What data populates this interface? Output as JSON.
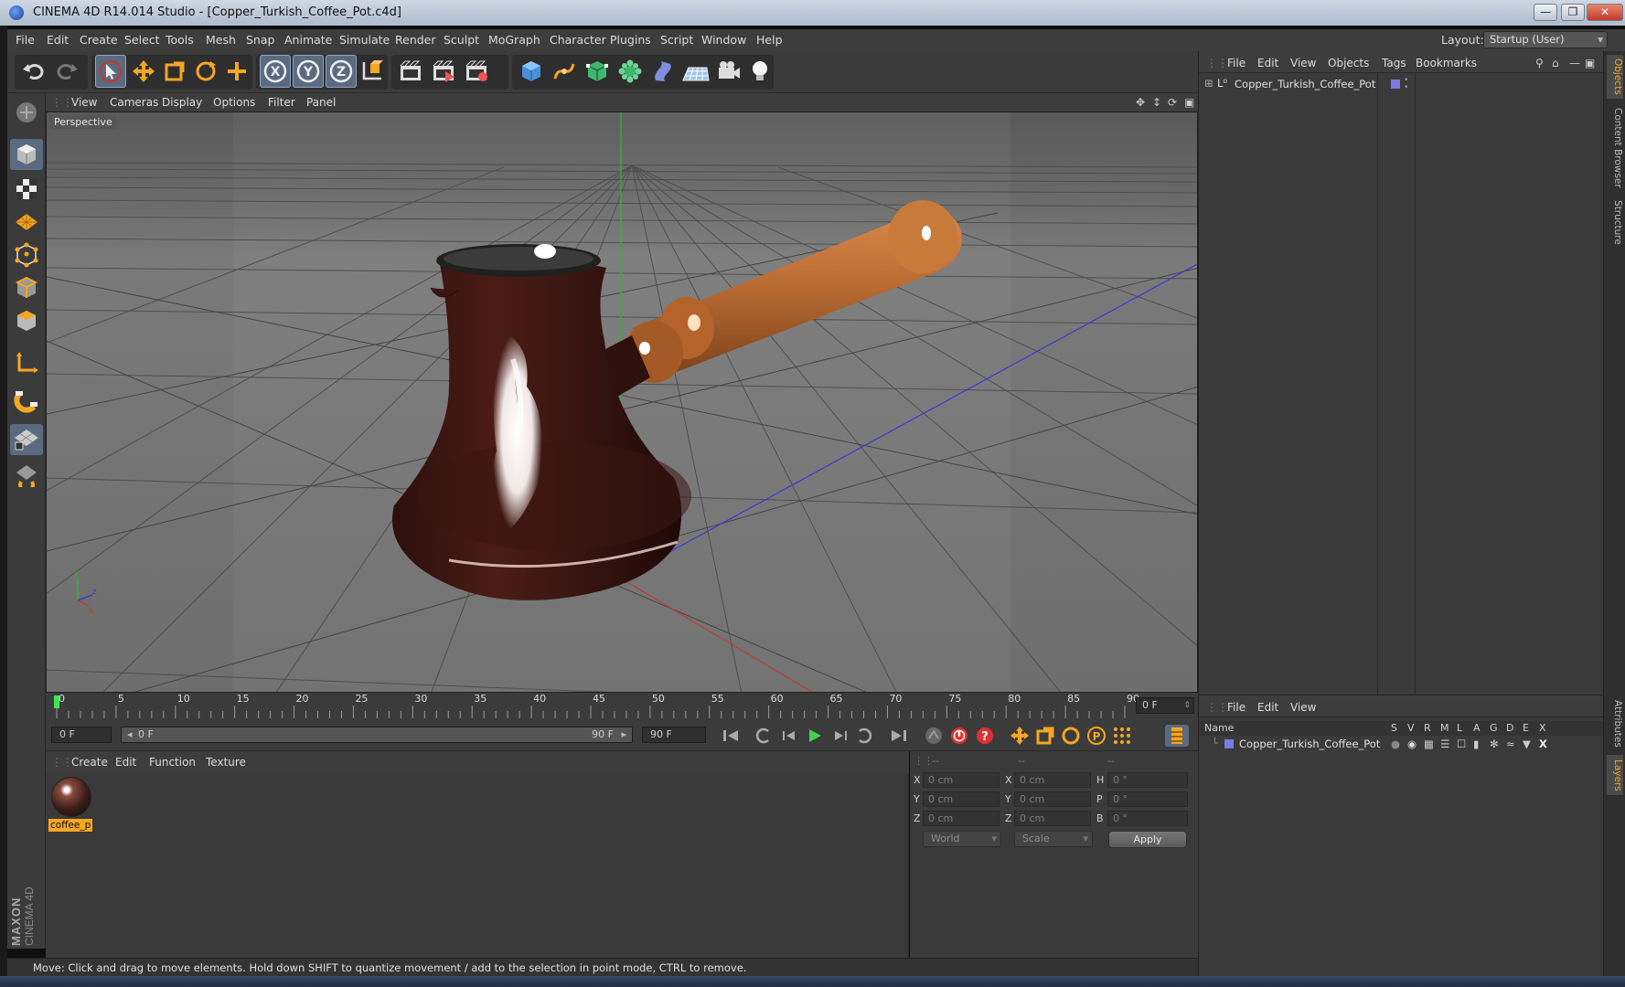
{
  "window": {
    "title": "CINEMA 4D R14.014 Studio - [Copper_Turkish_Coffee_Pot.c4d]",
    "minimize": "—",
    "restore": "❐",
    "close": "✕"
  },
  "menubar": {
    "items": [
      "File",
      "Edit",
      "Create",
      "Select",
      "Tools",
      "Mesh",
      "Snap",
      "Animate",
      "Simulate",
      "Render",
      "Sculpt",
      "MoGraph",
      "Character",
      "Plugins",
      "Script",
      "Window",
      "Help"
    ],
    "layout_label": "Layout:",
    "layout_value": "Startup (User)"
  },
  "toolbar": {
    "icons": [
      "undo-icon",
      "redo-icon",
      "select-arrow-icon",
      "move-icon",
      "scale-icon",
      "rotate-icon",
      "live-add-icon",
      "x-axis-icon",
      "y-axis-icon",
      "z-axis-icon",
      "coordinate-system-icon",
      "render-view-icon",
      "render-picture-viewer-icon",
      "render-settings-icon",
      "cube-icon",
      "spline-pen-icon",
      "subdivision-icon",
      "array-icon",
      "deformer-icon",
      "floor-icon",
      "camera-icon",
      "light-icon"
    ],
    "axis_labels": [
      "X",
      "Y",
      "Z"
    ]
  },
  "left_tools": [
    "make-editable-icon",
    "model-mode-icon",
    "texture-mode-icon",
    "workplane-icon",
    "points-mode-icon",
    "edges-mode-icon",
    "polygons-mode-icon",
    "axis-mode-icon",
    "magnet-icon",
    "grid-lock-icon",
    "snap-icon"
  ],
  "viewport": {
    "menu": [
      "View",
      "Cameras",
      "Display",
      "Options",
      "Filter",
      "Panel"
    ],
    "label": "Perspective",
    "axis_gizmo": {
      "x": "x",
      "y": "Y",
      "z": "z"
    }
  },
  "timeline": {
    "ticks": [
      "0",
      "5",
      "10",
      "15",
      "20",
      "25",
      "30",
      "35",
      "40",
      "45",
      "50",
      "55",
      "60",
      "65",
      "70",
      "75",
      "80",
      "85",
      "90"
    ],
    "current_frame": "0 F",
    "start_field": "0 F",
    "range_start": "0 F",
    "range_end": "90 F",
    "end_field": "90 F"
  },
  "material_manager": {
    "menu": [
      "Create",
      "Edit",
      "Function",
      "Texture"
    ],
    "materials": [
      {
        "name": "coffee_p"
      }
    ]
  },
  "coordinates": {
    "headers": [
      "--",
      "--",
      "--"
    ],
    "rows": [
      {
        "pos_label": "X",
        "pos": "0 cm",
        "size_label": "X",
        "size": "0 cm",
        "rot_label": "H",
        "rot": "0 °"
      },
      {
        "pos_label": "Y",
        "pos": "0 cm",
        "size_label": "Y",
        "size": "0 cm",
        "rot_label": "P",
        "rot": "0 °"
      },
      {
        "pos_label": "Z",
        "pos": "0 cm",
        "size_label": "Z",
        "size": "0 cm",
        "rot_label": "B",
        "rot": "0 °"
      }
    ],
    "world_select": "World",
    "scale_select": "Scale",
    "apply": "Apply"
  },
  "object_manager": {
    "menu": [
      "File",
      "Edit",
      "View",
      "Objects",
      "Tags",
      "Bookmarks"
    ],
    "objects": [
      {
        "name": "Copper_Turkish_Coffee_Pot",
        "color": "#7a7adf"
      }
    ]
  },
  "layer_manager": {
    "menu": [
      "File",
      "Edit",
      "View"
    ],
    "columns": [
      "Name",
      "S",
      "V",
      "R",
      "M",
      "L",
      "A",
      "G",
      "D",
      "E",
      "X"
    ],
    "rows": [
      {
        "name": "Copper_Turkish_Coffee_Pot",
        "color": "#7a7adf"
      }
    ]
  },
  "right_tabs": [
    "Objects",
    "Content Browser",
    "Structure",
    "Attributes",
    "Layers"
  ],
  "status": {
    "text": "Move: Click and drag to move elements. Hold down SHIFT to quantize movement / add to the selection in point mode, CTRL to remove."
  },
  "logo": {
    "line1": "MAXON",
    "line2": "CINEMA 4D"
  },
  "colors": {
    "accent": "#f5a623",
    "panel": "#3a3a3a",
    "active_tool": "#5a6a80",
    "pot_body": "#3a1612",
    "handle": "#b86b32"
  }
}
